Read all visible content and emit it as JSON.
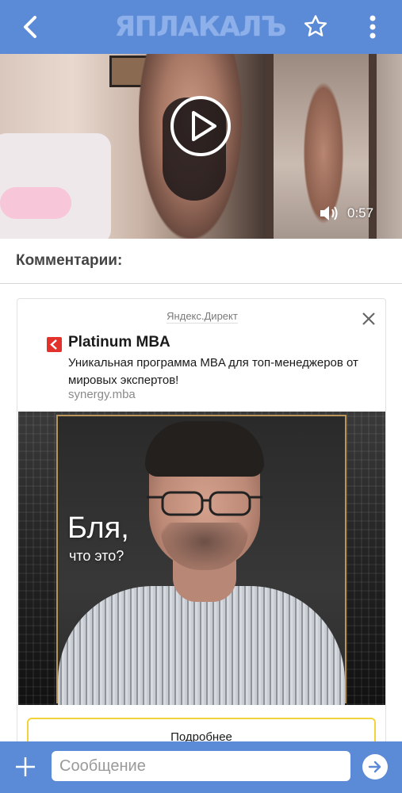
{
  "header": {
    "logo_text": "ЯПЛАКАЛЪ",
    "back_icon": "back-arrow-icon",
    "favorite_icon": "star-outline-icon",
    "menu_icon": "more-vertical-icon"
  },
  "video": {
    "duration": "0:57",
    "play_icon": "play-icon",
    "sound_icon": "volume-icon"
  },
  "comments": {
    "title": "Комментарии:"
  },
  "ad": {
    "source_label": "Яндекс.Директ",
    "close_icon": "close-icon",
    "brand_title": "Platinum MBA",
    "description": "Уникальная программа MBA для топ-менеджеров от мировых экспертов!",
    "domain": "synergy.mba",
    "creative_headline": "Бля,",
    "creative_subline": "что это?",
    "cta_label": "Подробнее"
  },
  "composer": {
    "placeholder": "Сообщение",
    "value": "",
    "add_icon": "plus-icon",
    "send_icon": "send-arrow-icon"
  },
  "colors": {
    "bar_blue": "#5b8ad6",
    "logo": "#8db0ea",
    "cta_border": "#f2d33b",
    "brand_red": "#e3322b"
  }
}
